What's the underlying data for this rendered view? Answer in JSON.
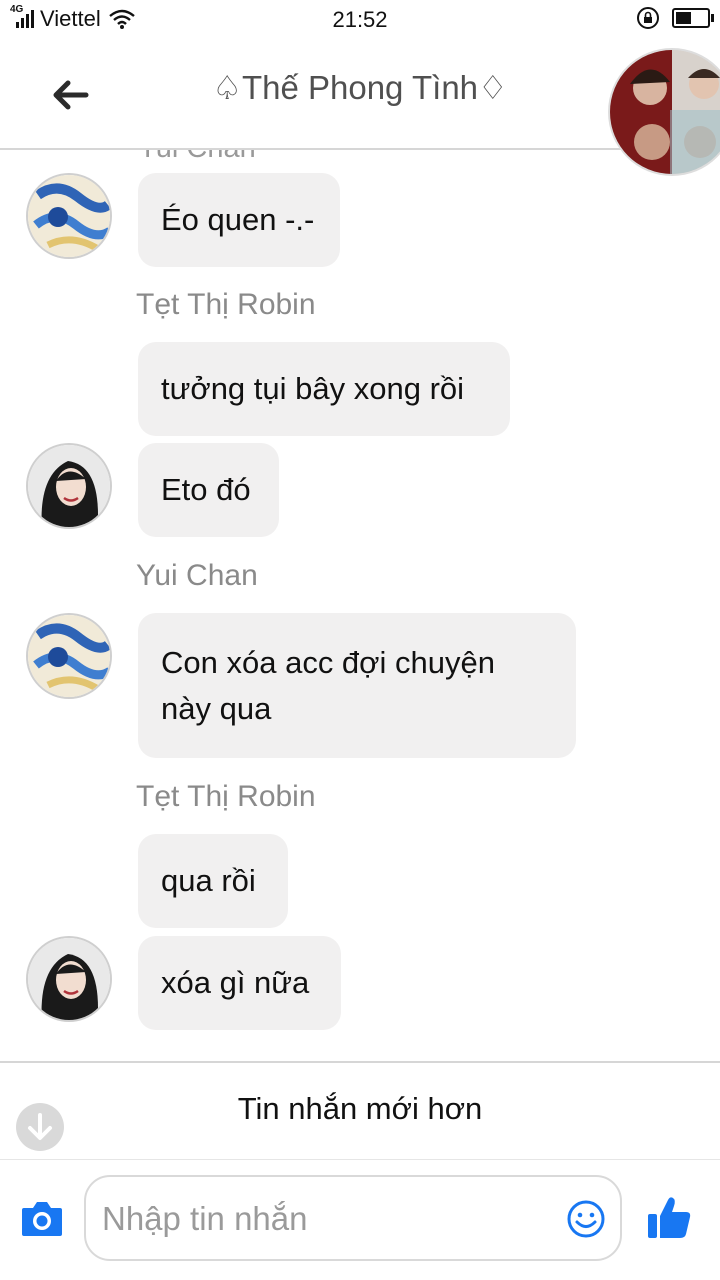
{
  "status_bar": {
    "network": "4G",
    "carrier": "Viettel",
    "time": "21:52",
    "battery_level": 0.5
  },
  "header": {
    "title": "♤Thế Phong Tình♢",
    "back_icon": "arrow-left-icon"
  },
  "messages": {
    "partial_sender": "Yui Chan",
    "items": [
      {
        "sender": "",
        "text": "Éo quen -.-",
        "avatar": "yui-chan"
      },
      {
        "sender": "Tẹt Thị Robin",
        "text": "tưởng tụi bây xong rồi",
        "avatar": ""
      },
      {
        "sender": "",
        "text": "Eto đó",
        "avatar": "robin"
      },
      {
        "sender": "Yui Chan",
        "text": "Con xóa acc đợi chuyện này qua",
        "avatar": "yui-chan"
      },
      {
        "sender": "Tẹt Thị Robin",
        "text": "qua rồi",
        "avatar": ""
      },
      {
        "sender": "",
        "text": "xóa gì nữa",
        "avatar": "robin"
      }
    ]
  },
  "newer_bar": {
    "label": "Tin nhắn mới hơn"
  },
  "composer": {
    "placeholder": "Nhập tin nhắn",
    "value": ""
  },
  "colors": {
    "accent": "#1877f2",
    "bubble": "#f1f0f0",
    "sender_text": "#8a8a8a"
  }
}
